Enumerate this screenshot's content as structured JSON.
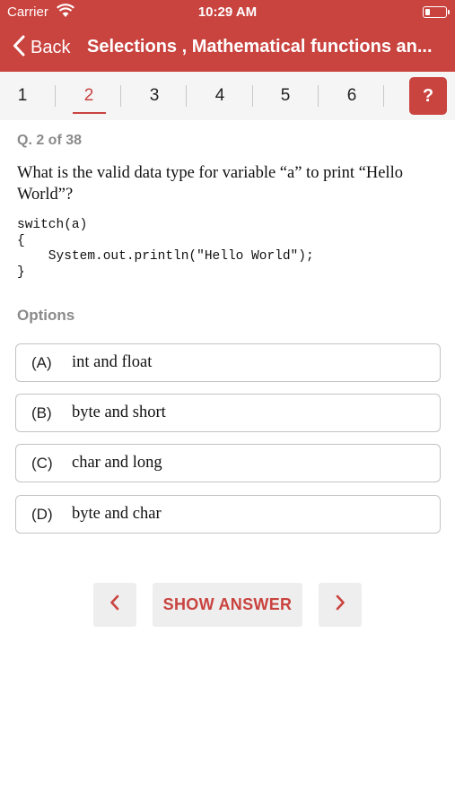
{
  "status_bar": {
    "carrier": "Carrier",
    "time": "10:29 AM"
  },
  "nav": {
    "back_label": "Back",
    "title": "Selections , Mathematical functions an..."
  },
  "tabs": {
    "items": [
      "1",
      "2",
      "3",
      "4",
      "5",
      "6"
    ],
    "active_index": 1,
    "help_label": "?"
  },
  "question": {
    "counter": "Q. 2 of 38",
    "text": "What is the valid data type for variable “a” to print “Hello World”?",
    "code": "switch(a)\n{\n    System.out.println(\"Hello World\");\n}"
  },
  "options": {
    "label": "Options",
    "items": [
      {
        "letter": "(A)",
        "text": "int and float"
      },
      {
        "letter": "(B)",
        "text": "byte and short"
      },
      {
        "letter": "(C)",
        "text": "char and long"
      },
      {
        "letter": "(D)",
        "text": "byte and char"
      }
    ]
  },
  "controls": {
    "show_answer_label": "SHOW ANSWER"
  },
  "colors": {
    "accent": "#c9433f",
    "muted_text": "#8a8a8a",
    "tab_bar_bg": "#f5f5f6"
  }
}
